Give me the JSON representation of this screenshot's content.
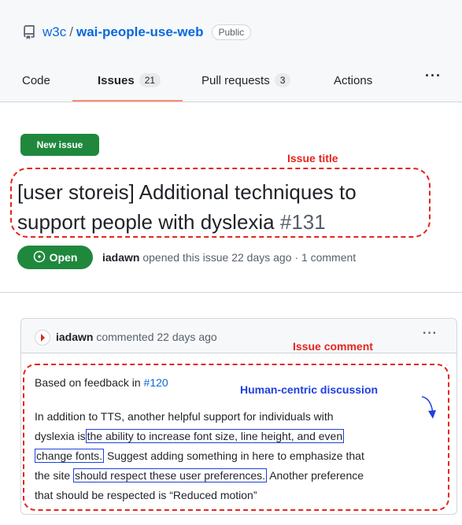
{
  "repo": {
    "owner": "w3c",
    "separator": "/",
    "name": "wai-people-use-web",
    "visibility": "Public"
  },
  "nav": {
    "code": "Code",
    "issues": "Issues",
    "issues_count": "21",
    "pull_requests": "Pull requests",
    "pull_requests_count": "3",
    "actions": "Actions",
    "more": "···"
  },
  "issue": {
    "new_issue_label": "New issue",
    "title_line1": "[user storeis] Additional techniques to",
    "title_line2": "support people with dyslexia",
    "number": "#131",
    "state": "Open",
    "author": "iadawn",
    "meta_rest": "opened this issue 22 days ago · 1 comment"
  },
  "comment": {
    "author": "iadawn",
    "meta": "commented 22 days ago",
    "more": "···",
    "line1_prefix": "Based on feedback in",
    "line1_ref": "#120",
    "p_l1": "In addition to TTS, another helpful support for individuals with",
    "p_l2_a": "dyslexia is",
    "p_l2_hl": "the ability to increase font size, line height, and even",
    "p_l3_hl": "change fonts.",
    "p_l3_b": "Suggest adding something in here to emphasize that",
    "p_l4_a": "the site",
    "p_l4_hl": "should respect these user preferences.",
    "p_l4_b": "Another preference",
    "p_l5": "that should be respected is “Reduced motion”"
  },
  "annotations": {
    "issue_title": "Issue title",
    "issue_comment": "Issue comment",
    "human_centric": "Human-centric discussion"
  },
  "colors": {
    "accent_link": "#0969da",
    "success_green": "#1f883d",
    "annotation_red": "#e5251e",
    "annotation_blue": "#2040e0",
    "tab_underline": "#fd8c73"
  },
  "icons": [
    "repo-icon",
    "issue-opened-icon",
    "kebab-horizontal-icon",
    "avatar-icon",
    "curved-arrow-icon"
  ]
}
